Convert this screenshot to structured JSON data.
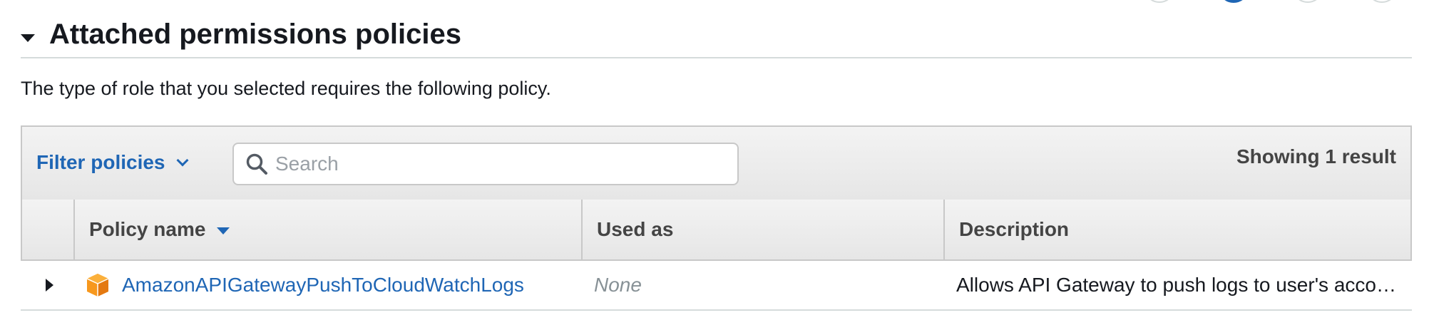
{
  "section": {
    "title": "Attached permissions policies",
    "description": "The type of role that you selected requires the following policy."
  },
  "toolbar": {
    "filter_label": "Filter policies",
    "search_placeholder": "Search",
    "search_value": "",
    "result_count": "Showing 1 result"
  },
  "table": {
    "columns": [
      "Policy name",
      "Used as",
      "Description"
    ],
    "sorted_column": "Policy name",
    "sort_direction": "descending",
    "rows": [
      {
        "policy_name": "AmazonAPIGatewayPushToCloudWatchLogs",
        "used_as": "None",
        "description": "Allows API Gateway to push logs to user's account."
      }
    ]
  },
  "wizard": {
    "steps": 4,
    "active_step": 2
  },
  "icons": {
    "section_toggle": "caret-down-icon",
    "filter_dropdown": "chevron-down-icon",
    "search": "search-icon",
    "sort": "sort-caret-icon",
    "row_expand": "caret-right-icon",
    "policy": "aws-managed-policy-icon"
  },
  "colors": {
    "link": "#1f66b5",
    "policy_icon": "#f7981d",
    "muted": "#879196",
    "header_bg": "#ececec"
  }
}
